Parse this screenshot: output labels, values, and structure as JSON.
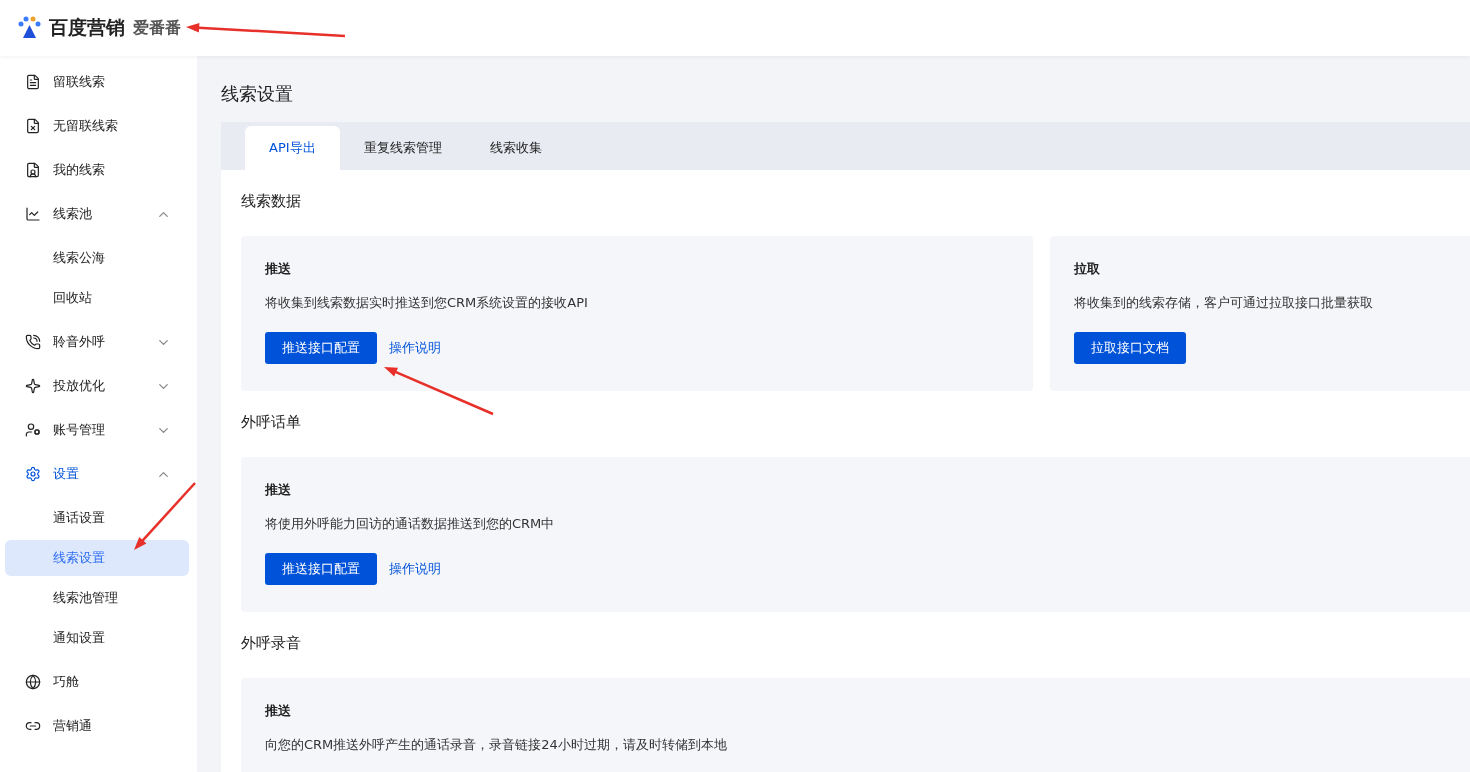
{
  "header": {
    "brand": "百度营销",
    "product": "爱番番"
  },
  "sidebar": {
    "items": [
      {
        "label": "留联线索",
        "selected": false
      },
      {
        "label": "无留联线索",
        "selected": false
      },
      {
        "label": "我的线索",
        "selected": false
      },
      {
        "label": "线索池",
        "selected": false,
        "expanded": true,
        "children": [
          {
            "label": "线索公海",
            "selected": false
          },
          {
            "label": "回收站",
            "selected": false
          }
        ]
      },
      {
        "label": "聆音外呼",
        "selected": false,
        "expanded": false
      },
      {
        "label": "投放优化",
        "selected": false,
        "expanded": false
      },
      {
        "label": "账号管理",
        "selected": false,
        "expanded": false
      },
      {
        "label": "设置",
        "selected": true,
        "expanded": true,
        "children": [
          {
            "label": "通话设置",
            "selected": false
          },
          {
            "label": "线索设置",
            "selected": true
          },
          {
            "label": "线索池管理",
            "selected": false
          },
          {
            "label": "通知设置",
            "selected": false
          }
        ]
      },
      {
        "label": "巧舱",
        "selected": false
      },
      {
        "label": "营销通",
        "selected": false
      }
    ]
  },
  "page": {
    "title": "线索设置",
    "tabs": [
      {
        "label": "API导出",
        "selected": true
      },
      {
        "label": "重复线索管理",
        "selected": false
      },
      {
        "label": "线索收集",
        "selected": false
      }
    ],
    "sections": [
      {
        "title": "线索数据",
        "panels": [
          {
            "heading": "推送",
            "text": "将收集到线索数据实时推送到您CRM系统设置的接收API",
            "button": "推送接口配置",
            "link": "操作说明"
          },
          {
            "heading": "拉取",
            "text": "将收集到的线索存储，客户可通过拉取接口批量获取",
            "button": "拉取接口文档"
          }
        ]
      },
      {
        "title": "外呼话单",
        "panels": [
          {
            "heading": "推送",
            "text": "将使用外呼能力回访的通话数据推送到您的CRM中",
            "button": "推送接口配置",
            "link": "操作说明"
          }
        ]
      },
      {
        "title": "外呼录音",
        "panels": [
          {
            "heading": "推送",
            "text": "向您的CRM推送外呼产生的通话录音，录音链接24小时过期，请及时转储到本地"
          }
        ]
      }
    ]
  }
}
